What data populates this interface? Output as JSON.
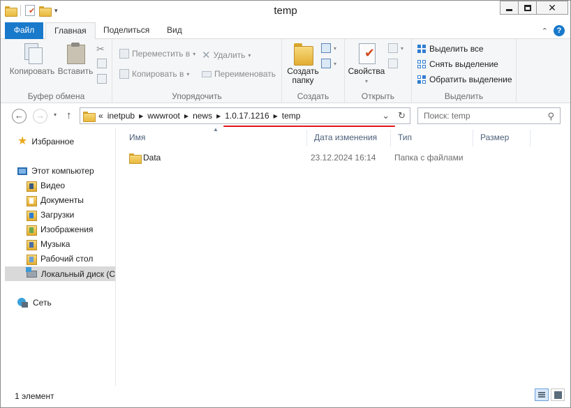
{
  "window": {
    "title": "temp"
  },
  "title_buttons": {
    "close": "✕"
  },
  "ribbon_tabs": {
    "file": "Файл",
    "home": "Главная",
    "share": "Поделиться",
    "view": "Вид"
  },
  "ribbon": {
    "clipboard": {
      "copy": "Копировать",
      "paste": "Вставить",
      "label": "Буфер обмена"
    },
    "organize": {
      "move": "Переместить в",
      "copy_to": "Копировать в",
      "delete": "Удалить",
      "rename": "Переименовать",
      "label": "Упорядочить"
    },
    "create": {
      "new_folder_line1": "Создать",
      "new_folder_line2": "папку",
      "label": "Создать"
    },
    "open": {
      "properties": "Свойства",
      "label": "Открыть"
    },
    "select": {
      "select_all": "Выделить все",
      "select_none": "Снять выделение",
      "invert": "Обратить выделение",
      "label": "Выделить"
    }
  },
  "address": {
    "overflow": "«",
    "crumbs": [
      "inetpub",
      "wwwroot",
      "news",
      "1.0.17.1216",
      "temp"
    ],
    "search_placeholder": "Поиск: temp"
  },
  "nav": {
    "favorites": "Избранное",
    "this_pc": "Этот компьютер",
    "items": [
      "Видео",
      "Документы",
      "Загрузки",
      "Изображения",
      "Музыка",
      "Рабочий стол",
      "Локальный диск (C"
    ],
    "network": "Сеть"
  },
  "columns": {
    "name": "Имя",
    "date": "Дата изменения",
    "type": "Тип",
    "size": "Размер"
  },
  "files": [
    {
      "name": "Data",
      "date": "23.12.2024 16:14",
      "type": "Папка с файлами",
      "size": ""
    }
  ],
  "status": {
    "count": "1 элемент"
  },
  "colors": {
    "file_tab": "#1979ca",
    "annotation_underline": "#e0141b",
    "selection": "#d9d9d9"
  }
}
